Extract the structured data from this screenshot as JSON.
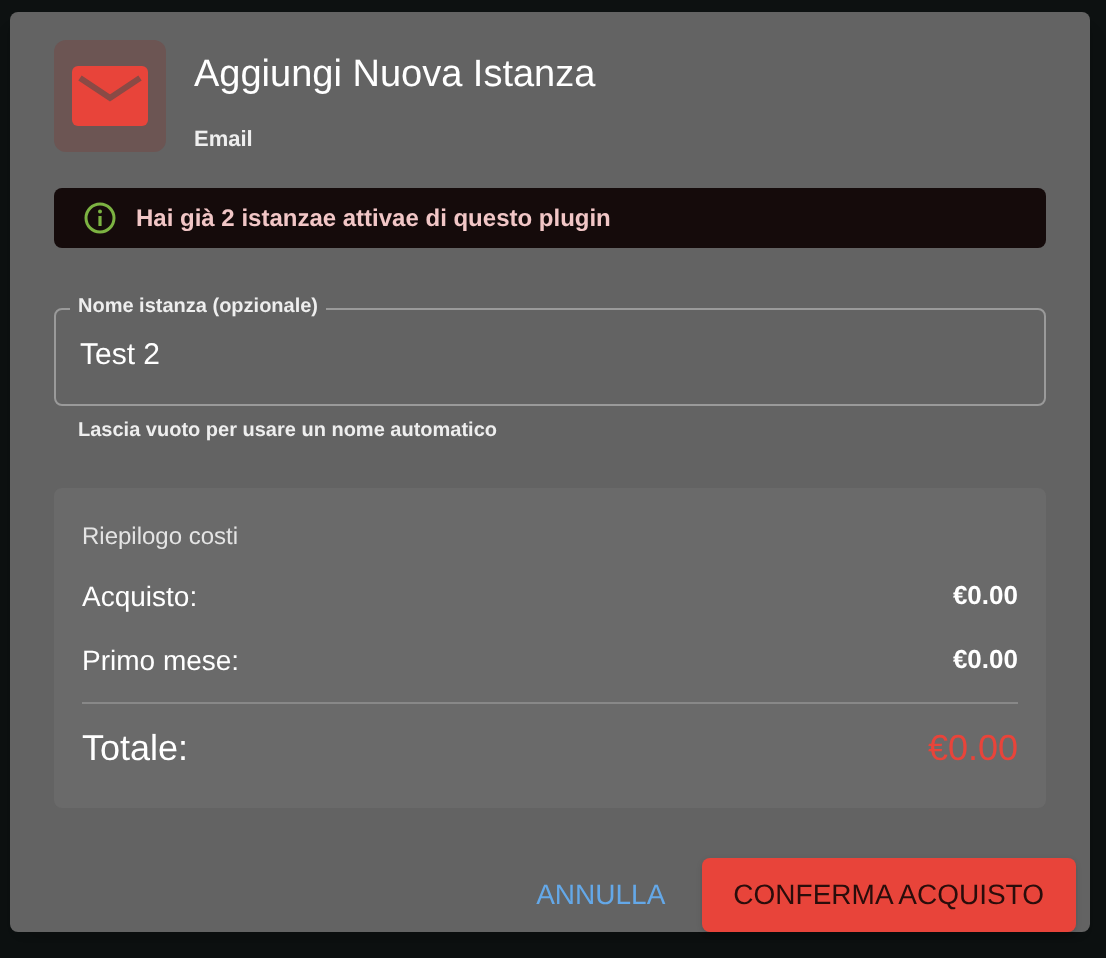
{
  "dialog": {
    "title": "Aggiungi Nuova Istanza",
    "subtitle": "Email",
    "alert": {
      "text": "Hai già 2 istanzae attivae di questo plugin"
    },
    "field": {
      "label": "Nome istanza (opzionale)",
      "value": "Test 2",
      "helper": "Lascia vuoto per usare un nome automatico"
    },
    "summary": {
      "title": "Riepilogo costi",
      "rows": [
        {
          "label": "Acquisto:",
          "value": "€0.00"
        },
        {
          "label": "Primo mese:",
          "value": "€0.00"
        }
      ],
      "total": {
        "label": "Totale:",
        "value": "€0.00"
      }
    },
    "buttons": [
      {
        "label": "ANNULLA",
        "kind": "text"
      },
      {
        "label": "CONFERMA ACQUISTO",
        "kind": "primary"
      }
    ]
  }
}
